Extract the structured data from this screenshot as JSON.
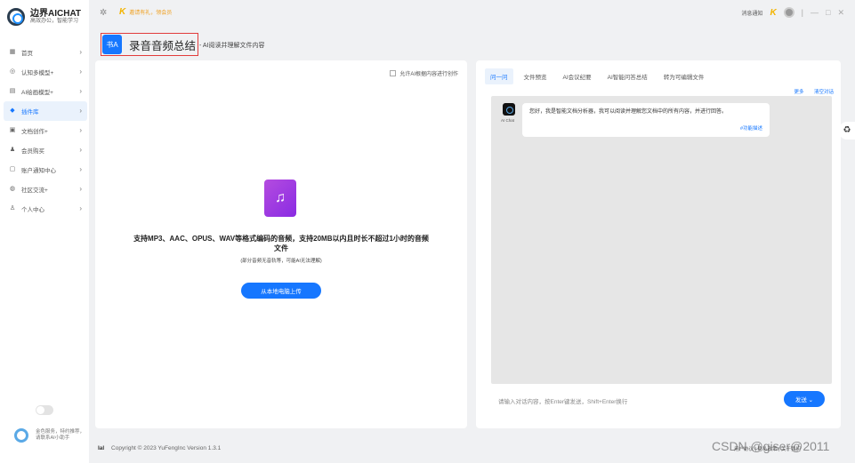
{
  "app": {
    "title": "边界AICHAT",
    "subtitle": "高效办公，智能学习"
  },
  "sidebar": {
    "items": [
      {
        "label": "首页",
        "icon": "home-icon",
        "glyph": "▦"
      },
      {
        "label": "认知多模型+",
        "icon": "brain-icon",
        "glyph": "◎"
      },
      {
        "label": "AI绘画模型+",
        "icon": "image-icon",
        "glyph": "▤"
      },
      {
        "label": "插件库",
        "icon": "plugin-icon",
        "glyph": "◆"
      },
      {
        "label": "文档创作+",
        "icon": "document-icon",
        "glyph": "▣"
      },
      {
        "label": "会员购买",
        "icon": "user-icon",
        "glyph": "♟"
      },
      {
        "label": "账户通知中心",
        "icon": "notice-icon",
        "glyph": "▢"
      },
      {
        "label": "社区交流+",
        "icon": "community-icon",
        "glyph": "◍"
      },
      {
        "label": "个人中心",
        "icon": "person-icon",
        "glyph": "♙"
      }
    ],
    "active_index": 3,
    "footer_text": "金色服务，特约推荐，请联系AI小助手"
  },
  "topbar": {
    "promo": "邀请有礼，领会员",
    "right_items": [
      "消息通知"
    ],
    "window_controls": [
      "—",
      "□",
      "✕"
    ]
  },
  "page": {
    "title": "录音音频总结",
    "subtitle": "- AI阅读并理解文件内容",
    "icon_glyph": "书A"
  },
  "upload": {
    "checkbox_label": "允许AI根据内容进行创作",
    "main_text": "支持MP3、AAC、OPUS、WAV等格式编码的音频，支持20MB以内且时长不超过1小时的音频文件",
    "sub_text": "(部分音频无音轨等，可能AI无法理解)",
    "button": "从本地电脑上传"
  },
  "chat": {
    "tabs": [
      "问一问",
      "文件预览",
      "AI会议纪要",
      "AI智能问答总结",
      "转为可编辑文件"
    ],
    "active_tab": 0,
    "links": [
      "更多",
      "清空对话"
    ],
    "bot_name": "AI Chat",
    "bubble_text": "您好，我是智能文档分析器，我可以阅读并理解您文档中的所有内容，并进行回答。",
    "bubble_link": "#功能描述",
    "input_placeholder": "请输入对话内容，按Enter键发送，Shift+Enter换行",
    "send_button": "发送 ⌄"
  },
  "footer": {
    "brand": "Ial",
    "copyright": "Copyright © 2023 YuFengInc Version 1.3.1",
    "right_text": "用户协议 | 隐私政策 | 关于我们"
  },
  "watermark": "CSDN @giser@2011"
}
